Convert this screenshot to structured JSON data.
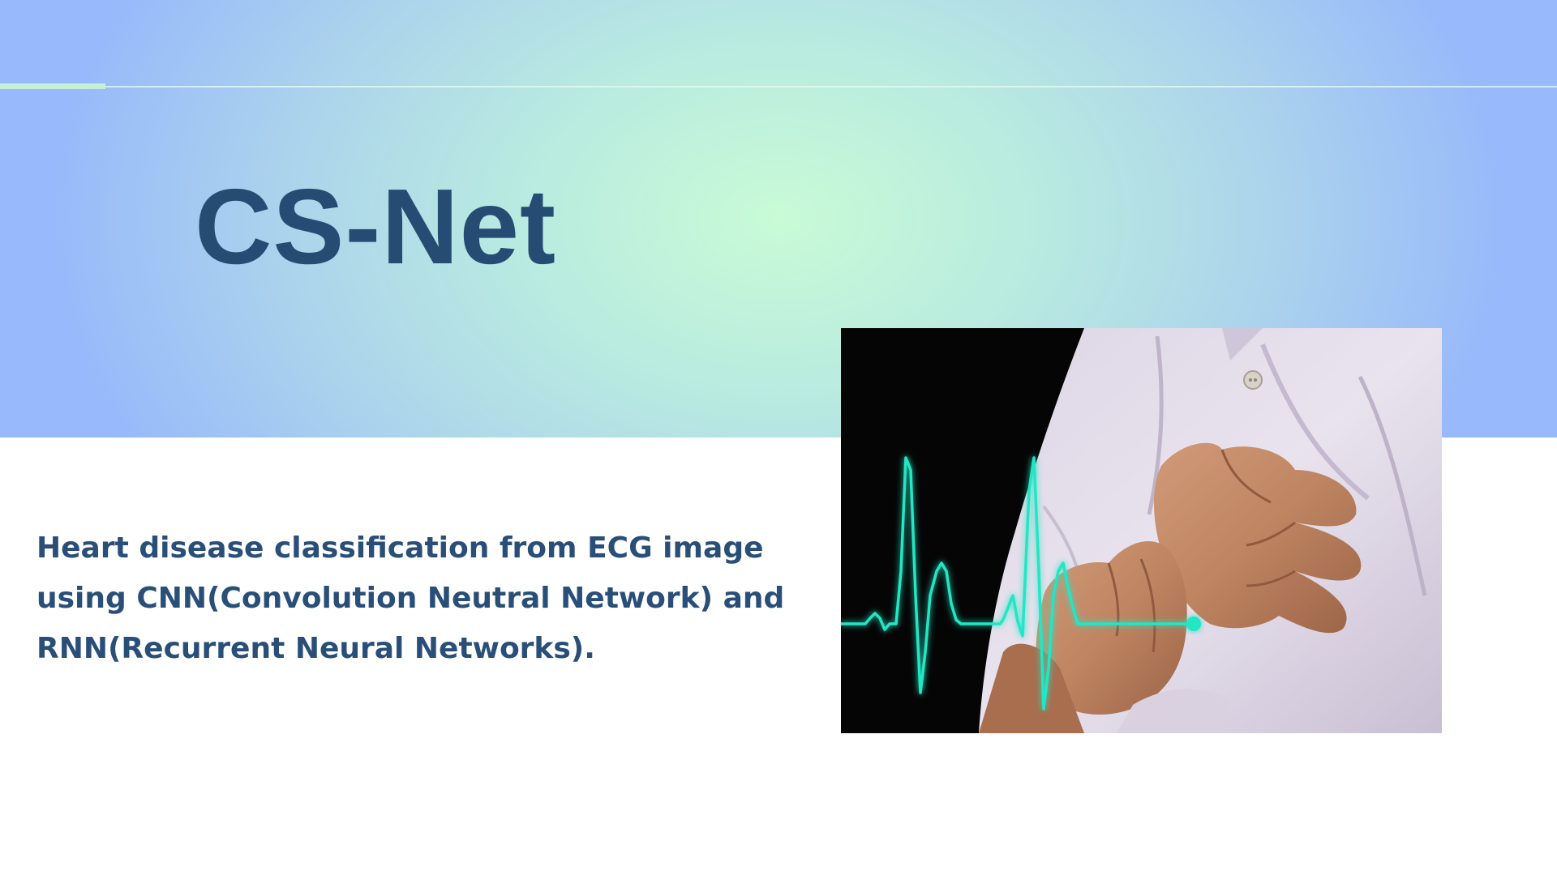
{
  "slide": {
    "title": "CS-Net",
    "description": "Heart disease classification from ECG image using CNN(Convolution Neutral Network) and RNN(Recurrent Neural Networks).",
    "photo_icon": "chest-pain-ecg-photo"
  },
  "colors": {
    "title": "#264c73",
    "description": "#294f79",
    "gradient_center": "#c8fbd6",
    "gradient_edge": "#98b9fb",
    "ecg_line": "#22e6c4"
  }
}
